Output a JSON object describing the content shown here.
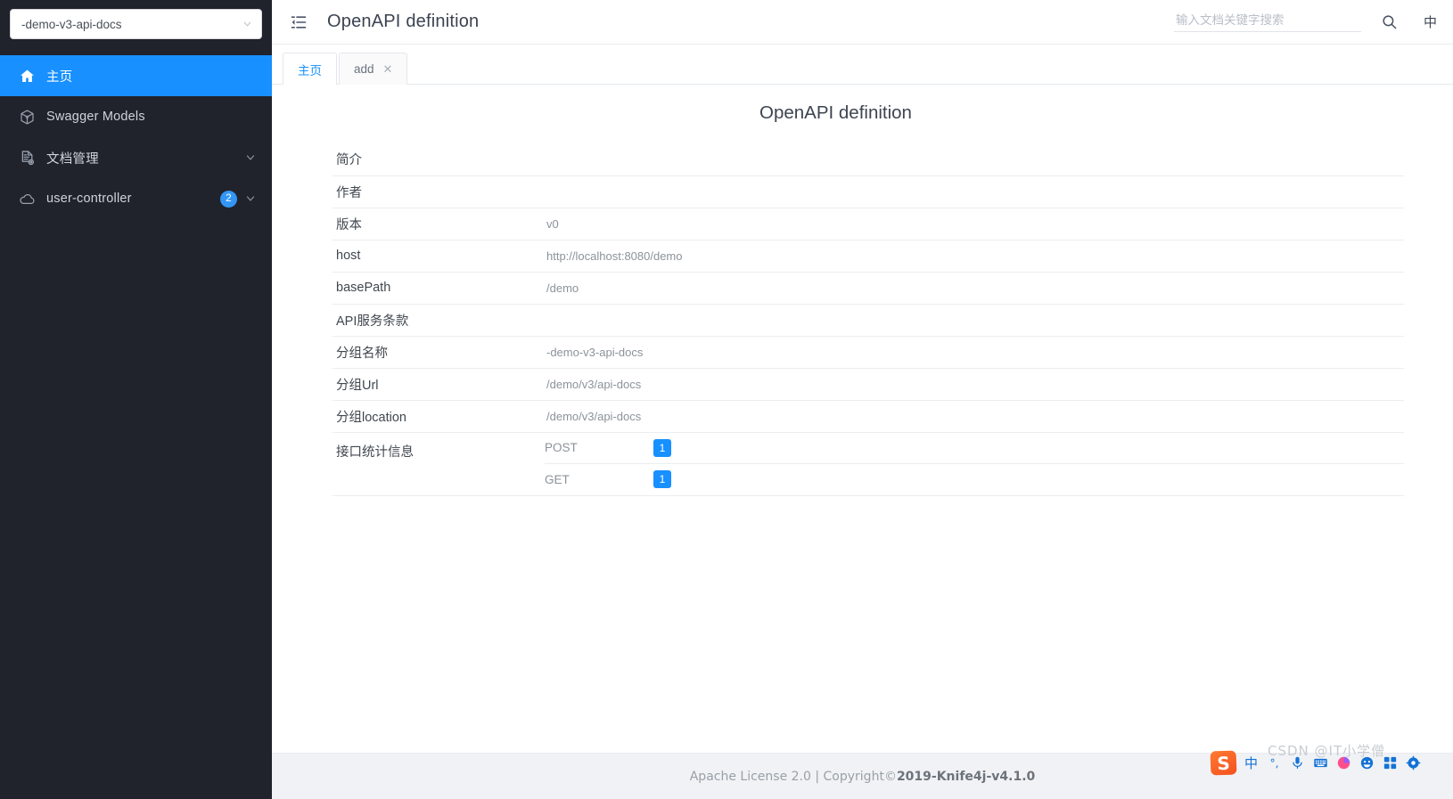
{
  "sidebar": {
    "group_select": {
      "value": "-demo-v3-api-docs",
      "icon": "chevron-down-icon"
    },
    "items": [
      {
        "label": "主页",
        "icon": "home-icon",
        "active": true,
        "badge": null,
        "arrow": false
      },
      {
        "label": "Swagger Models",
        "icon": "cube-icon",
        "active": false,
        "badge": null,
        "arrow": false
      },
      {
        "label": "文档管理",
        "icon": "document-settings-icon",
        "active": false,
        "badge": null,
        "arrow": true
      },
      {
        "label": "user-controller",
        "icon": "cloud-icon",
        "active": false,
        "badge": "2",
        "arrow": true
      }
    ]
  },
  "topbar": {
    "fold_icon": "menu-fold-icon",
    "title": "OpenAPI definition",
    "search_placeholder": "输入文档关键字搜索",
    "search_value": "",
    "search_icon": "search-icon",
    "language_label": "中"
  },
  "tabs": [
    {
      "label": "主页",
      "active": true,
      "closable": false
    },
    {
      "label": "add",
      "active": false,
      "closable": true,
      "close_label": "✕"
    }
  ],
  "content": {
    "title": "OpenAPI definition",
    "rows": [
      {
        "key": "简介",
        "value": ""
      },
      {
        "key": "作者",
        "value": ""
      },
      {
        "key": "版本",
        "value": "v0"
      },
      {
        "key": "host",
        "value": "http://localhost:8080/demo"
      },
      {
        "key": "basePath",
        "value": "/demo"
      },
      {
        "key": "API服务条款",
        "value": ""
      },
      {
        "key": "分组名称",
        "value": "-demo-v3-api-docs"
      },
      {
        "key": "分组Url",
        "value": "/demo/v3/api-docs"
      },
      {
        "key": "分组location",
        "value": "/demo/v3/api-docs"
      }
    ],
    "stats_label": "接口统计信息",
    "stats": [
      {
        "method": "POST",
        "count": "1"
      },
      {
        "method": "GET",
        "count": "1"
      }
    ]
  },
  "footer": {
    "license": "Apache License 2.0 | Copyright ",
    "copyright_symbol": "©",
    "product": " 2019-Knife4j-v4.1.0"
  },
  "overlay": {
    "watermark": "CSDN @IT小学僧",
    "ime": {
      "logo": "S",
      "items": [
        {
          "name": "ime-mode-chinese",
          "glyph": "中"
        },
        {
          "name": "ime-punctuation",
          "glyph": "°,"
        },
        {
          "name": "ime-voice-icon",
          "glyph": ""
        },
        {
          "name": "ime-keyboard-icon",
          "glyph": ""
        },
        {
          "name": "ime-skin-icon",
          "glyph": ""
        },
        {
          "name": "ime-emoji-icon",
          "glyph": ""
        },
        {
          "name": "ime-toolbox-icon",
          "glyph": ""
        },
        {
          "name": "ime-settings-icon",
          "glyph": ""
        }
      ]
    }
  },
  "colors": {
    "sidebar_bg": "#20222c",
    "accent": "#1890ff",
    "footer_bg": "#f0f2f5"
  }
}
